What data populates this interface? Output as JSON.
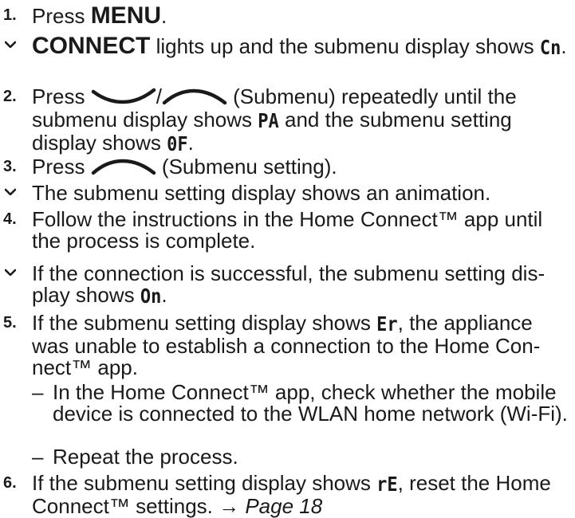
{
  "steps": {
    "s1": {
      "num": "1.",
      "prefix": "Press ",
      "key": "MENU",
      "suffix": "."
    },
    "r1": {
      "bold": "CONNECT",
      "text": " lights up and the submenu display shows ",
      "code": "Cn",
      "end": "."
    },
    "s2": {
      "num": "2.",
      "prefix": "Press ",
      "sep": "/",
      "mid": " (Submenu) repeatedly until the submenu display shows ",
      "code1": "PA",
      "mid2": " and the submenu setting display shows ",
      "code2": "0F",
      "end": "."
    },
    "s3": {
      "num": "3.",
      "prefix": "Press ",
      "suffix": " (Submenu setting)."
    },
    "r3": {
      "text": "The submenu setting display shows an animation."
    },
    "s4": {
      "num": "4.",
      "text": "Follow the instructions in the Home Connect™ app until the process is complete."
    },
    "r4": {
      "text": "If the connection is successful, the submenu setting dis­play shows ",
      "code": "On",
      "end": "."
    },
    "s5": {
      "num": "5.",
      "prefix": "If the submenu setting display shows ",
      "code": "Er",
      "suffix": ", the appliance was unable to establish a connection to the Home Con­nect™ app."
    },
    "s5a": {
      "dash": "–",
      "text": "In the Home Connect™ app, check whether the mo­bile device is connected to the WLAN home network (Wi-Fi)."
    },
    "s5b": {
      "dash": "–",
      "text": "Repeat the process."
    },
    "s6": {
      "num": "6.",
      "prefix": "If the submenu setting display shows ",
      "code": "rE",
      "suffix": ", reset the Home Connect™ settings. → ",
      "link": "Page 18"
    }
  },
  "icons": {
    "result": "checkmark-icon",
    "down": "chevron-down-icon",
    "up": "chevron-up-icon"
  }
}
